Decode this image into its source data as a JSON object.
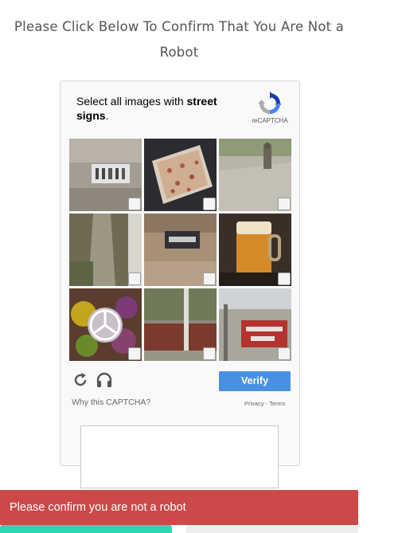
{
  "page": {
    "heading": "Please Click Below To Confirm That You Are Not a Robot"
  },
  "captcha": {
    "prompt_prefix": "Select all images with ",
    "prompt_keyword": "street signs",
    "prompt_suffix": ".",
    "brand": "reCAPTCHA",
    "verify_label": "Verify",
    "why_label": "Why this CAPTCHA?",
    "privacy_label": "Privacy",
    "legal_separator": " - ",
    "terms_label": "Terms",
    "tiles": [
      {
        "subject": "wall sign close-up",
        "checked": false
      },
      {
        "subject": "pizza",
        "checked": false
      },
      {
        "subject": "road with cyclist",
        "checked": false
      },
      {
        "subject": "tree trunk",
        "checked": false
      },
      {
        "subject": "building sign",
        "checked": false
      },
      {
        "subject": "glass of beer",
        "checked": false
      },
      {
        "subject": "vegetables",
        "checked": false
      },
      {
        "subject": "street with fence",
        "checked": false
      },
      {
        "subject": "wrong way sign",
        "checked": false
      }
    ]
  },
  "alert": {
    "message": "Please confirm you are not a robot"
  },
  "colors": {
    "verify": "#4a90e2",
    "alert": "#cc4949",
    "primary_button": "#2bd8b1"
  }
}
